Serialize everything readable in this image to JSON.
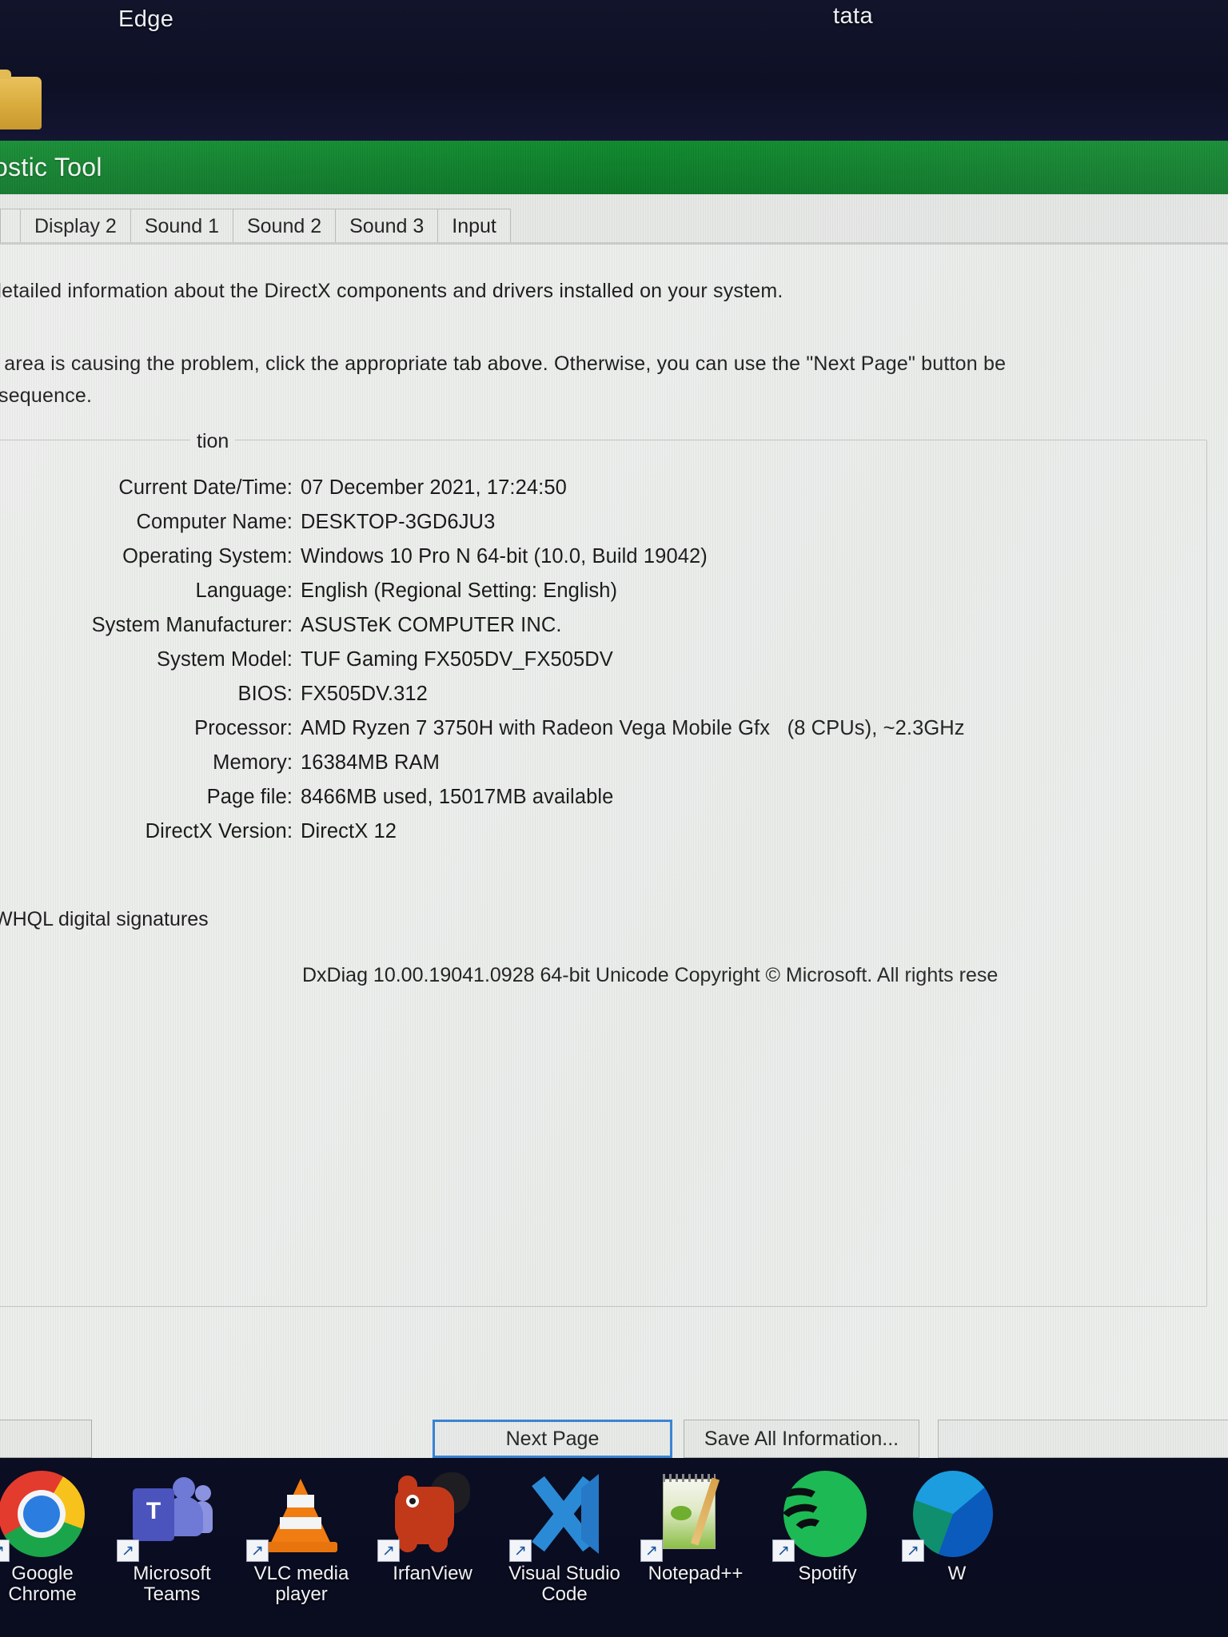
{
  "desktop": {
    "top_labels": [
      {
        "name": "edge",
        "text": "Edge"
      },
      {
        "name": "tata",
        "text": "tata"
      }
    ]
  },
  "window": {
    "title": "ostic Tool",
    "tabs": [
      {
        "label": ""
      },
      {
        "label": "Display 2"
      },
      {
        "label": "Sound 1"
      },
      {
        "label": "Sound 2"
      },
      {
        "label": "Sound 3"
      },
      {
        "label": "Input"
      }
    ],
    "intro": {
      "line1": "detailed information about the DirectX components and drivers installed on your system.",
      "line2": "n area is causing the problem, click the appropriate tab above. Otherwise, you can use the \"Next Page\" button be",
      "line3": "sequence."
    },
    "groupbox_legend": "tion",
    "info_rows": [
      {
        "label": "Current Date/Time:",
        "value": "07 December 2021, 17:24:50"
      },
      {
        "label": "Computer Name:",
        "value": "DESKTOP-3GD6JU3"
      },
      {
        "label": "Operating System:",
        "value": "Windows 10 Pro N 64-bit (10.0, Build 19042)"
      },
      {
        "label": "Language:",
        "value": "English (Regional Setting: English)"
      },
      {
        "label": "System Manufacturer:",
        "value": "ASUSTeK COMPUTER INC."
      },
      {
        "label": "System Model:",
        "value": "TUF Gaming FX505DV_FX505DV"
      },
      {
        "label": "BIOS:",
        "value": "FX505DV.312"
      },
      {
        "label": "Processor:",
        "value": "AMD Ryzen 7 3750H with Radeon Vega Mobile Gfx   (8 CPUs), ~2.3GHz"
      },
      {
        "label": "Memory:",
        "value": "16384MB RAM"
      },
      {
        "label": "Page file:",
        "value": "8466MB used, 15017MB available"
      },
      {
        "label": "DirectX Version:",
        "value": "DirectX 12"
      }
    ],
    "whql_text": "WHQL digital signatures",
    "copyright": "DxDiag 10.00.19041.0928 64-bit Unicode  Copyright © Microsoft. All rights rese",
    "buttons": {
      "help": "",
      "next_page": "Next Page",
      "save_all": "Save All Information...",
      "exit": ""
    }
  },
  "taskbar": {
    "apps": [
      {
        "name": "google-chrome",
        "label": "Google\nChrome"
      },
      {
        "name": "microsoft-teams",
        "label": "Microsoft\nTeams"
      },
      {
        "name": "vlc-media-player",
        "label": "VLC media\nplayer"
      },
      {
        "name": "irfanview",
        "label": "IrfanView"
      },
      {
        "name": "visual-studio-code",
        "label": "Visual Studio\nCode"
      },
      {
        "name": "notepad-plus-plus",
        "label": "Notepad++"
      },
      {
        "name": "spotify",
        "label": "Spotify"
      },
      {
        "name": "microsoft-edge",
        "label": "W"
      }
    ],
    "shortcut_glyph": "↗"
  },
  "colors": {
    "title_bar_green": "#0d7f2a",
    "focus_blue": "#2f7fd6",
    "window_face": "#eceeec",
    "desktop": "#0b0d22"
  }
}
